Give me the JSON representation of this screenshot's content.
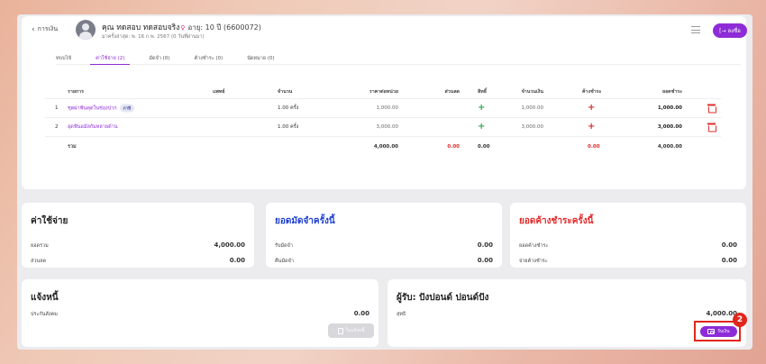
{
  "header": {
    "back_label": "การเงิน",
    "patient_name": "คุณ ทดสอบ ทดสอบจริง",
    "gender_symbol": "♀",
    "age_text": "อายุ: 10 ปี (6600072)",
    "visit_text": "มาครั้งล่าสุด: พ. 16 ก.พ. 2567 (0 วันที่ผ่านมา)",
    "logout_label": "ลงชื่อ"
  },
  "tabs": [
    {
      "label": "ทบบไข้"
    },
    {
      "label": "ค่าใช้จ่าย (2)",
      "active": true
    },
    {
      "label": "มัดจำ (0)"
    },
    {
      "label": "ค้างชำระ (0)"
    },
    {
      "label": "นัดหมาย (0)"
    }
  ],
  "table": {
    "headers": {
      "name": "รายการ",
      "doctor": "แพทย์",
      "qty": "จำนวน",
      "unit_price": "ราคาต่อหน่วย",
      "discount": "ส่วนลด",
      "coverage": "สิทธิ์",
      "amount": "จำนวนเงิน",
      "outstanding": "ค้างชำระ",
      "payable": "ยอดชำระ"
    },
    "rows": [
      {
        "no": "1",
        "name": "ชุดผ่าฟันคุดในช่องปาก",
        "badge": "ภาษี",
        "doctor": "",
        "qty": "1.00  ครั้ง",
        "unit_price": "1,000.00",
        "discount": "",
        "amount": "1,000.00",
        "payable": "1,000.00"
      },
      {
        "no": "2",
        "name": "อุดฟันอมัลกัมหลายด้าน",
        "badge": "",
        "doctor": "",
        "qty": "1.00  ครั้ง",
        "unit_price": "3,000.00",
        "discount": "",
        "amount": "3,000.00",
        "payable": "3,000.00"
      }
    ],
    "total": {
      "label": "รวม",
      "unit_price": "4,000.00",
      "discount": "0.00",
      "coverage": "0.00",
      "outstanding": "0.00",
      "payable": "4,000.00"
    }
  },
  "expense_card": {
    "title": "ค่าใช้จ่าย",
    "rows": [
      {
        "label": "ยอดรวม",
        "value": "4,000.00"
      },
      {
        "label": "ส่วนลด",
        "value": "0.00"
      }
    ]
  },
  "deposit_card": {
    "title": "ยอดมัดจำครั้งนี้",
    "rows": [
      {
        "label": "รับมัดจำ",
        "value": "0.00"
      },
      {
        "label": "คืนมัดจำ",
        "value": "0.00"
      }
    ]
  },
  "outstanding_card": {
    "title": "ยอดค้างชำระครั้งนี้",
    "rows": [
      {
        "label": "ยอดค้างชำระ",
        "value": "0.00"
      },
      {
        "label": "จ่ายค้างชำระ",
        "value": "0.00"
      }
    ]
  },
  "debt_card": {
    "title": "แจ้งหนี้",
    "row": {
      "label": "ประกันสังคม",
      "value": "0.00"
    },
    "receipt_label": "ใบแจ้งหนี้"
  },
  "payer_card": {
    "title": "ผู้รับ: ปังปอนด์ ปอนด์ปัง",
    "row": {
      "label": "สุทธิ",
      "value": "4,000.00"
    },
    "pay_label": "รับเงิน"
  },
  "annotation": {
    "step": "2"
  },
  "colors": {
    "accent": "#8e2bd8",
    "blue_title": "#1d3fd1",
    "red": "#e02b2b",
    "green": "#35a854"
  }
}
